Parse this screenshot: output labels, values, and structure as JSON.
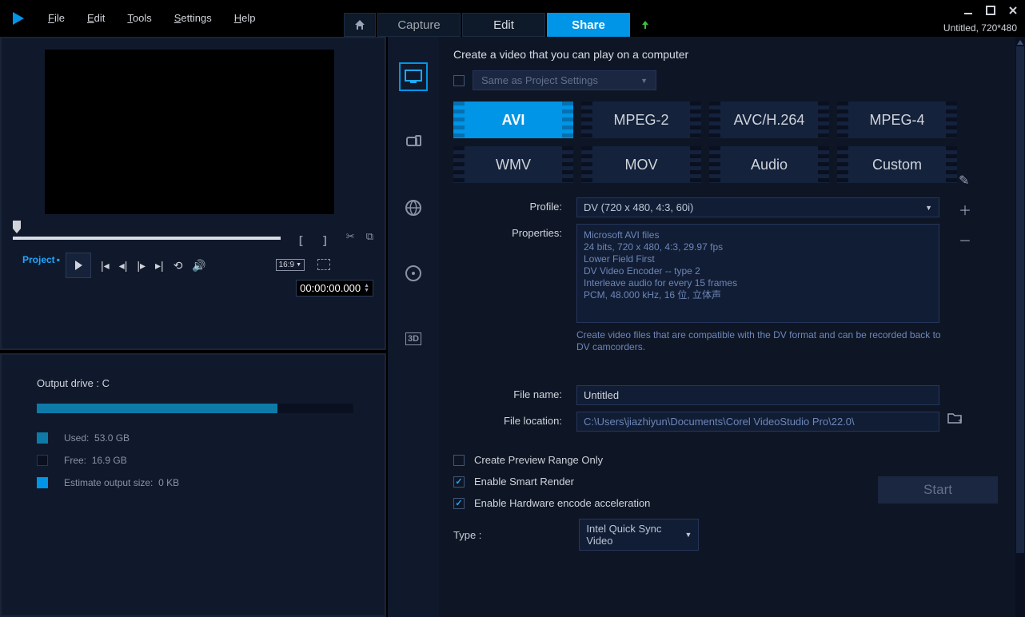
{
  "menus": {
    "file": "File",
    "edit": "Edit",
    "tools": "Tools",
    "settings": "Settings",
    "help": "Help"
  },
  "tabs": {
    "capture": "Capture",
    "edit": "Edit",
    "share": "Share"
  },
  "title_status": "Untitled, 720*480",
  "preview": {
    "project_label": "Project",
    "aspect": "16:9",
    "timecode": "00:00:00.000"
  },
  "output": {
    "title": "Output drive : C",
    "used_label": "Used:",
    "used_val": "53.0 GB",
    "free_label": "Free:",
    "free_val": "16.9 GB",
    "est_label": "Estimate output size:",
    "est_val": "0 KB",
    "progress_pct": 76
  },
  "share": {
    "heading": "Create a video that you can play on a computer",
    "same_as": "Same as Project Settings",
    "formats": [
      "AVI",
      "MPEG-2",
      "AVC/H.264",
      "MPEG-4",
      "WMV",
      "MOV",
      "Audio",
      "Custom"
    ],
    "profile_label": "Profile:",
    "profile_value": "DV (720 x 480, 4:3, 60i)",
    "properties_label": "Properties:",
    "properties_text": "Microsoft AVI files\n24 bits, 720 x 480, 4:3, 29.97 fps\nLower Field First\nDV Video Encoder -- type 2\nInterleave audio for every 15 frames\nPCM, 48.000 kHz, 16 位, 立体声",
    "hint": "Create video files that are compatible with the DV format and can be recorded back to DV camcorders.",
    "filename_label": "File name:",
    "filename_value": "Untitled",
    "filelocation_label": "File location:",
    "filelocation_value": "C:\\Users\\jiazhiyun\\Documents\\Corel VideoStudio Pro\\22.0\\",
    "opt_preview": "Create Preview Range Only",
    "opt_smart": "Enable Smart Render",
    "opt_hw": "Enable Hardware encode acceleration",
    "type_label": "Type :",
    "type_value": "Intel Quick Sync Video",
    "start": "Start"
  }
}
